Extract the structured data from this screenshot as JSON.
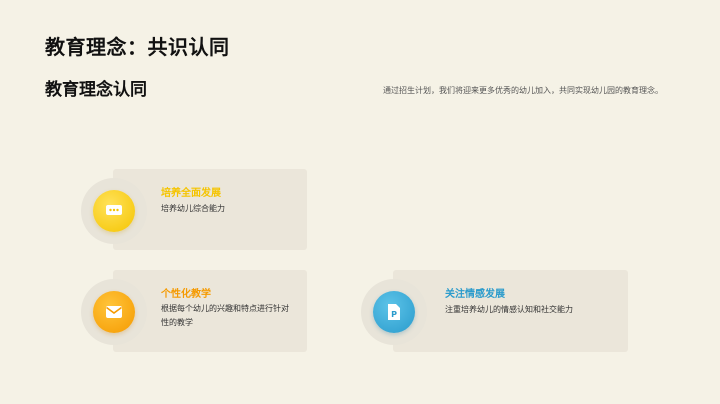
{
  "slide": {
    "title": "教育理念：共识认同",
    "subtitle": "教育理念认同",
    "description": "通过招生计划，我们将迎来更多优秀的幼儿加入，共同实现幼儿园的教育理念。"
  },
  "cards": [
    {
      "title": "培养全面发展",
      "text": "培养幼儿综合能力",
      "color": "#f5c400",
      "icon": "chat-bubble-icon"
    },
    {
      "title": "个性化教学",
      "text": "根据每个幼儿的兴趣和特点进行针对性的教学",
      "color": "#f59a00",
      "icon": "mail-icon"
    },
    {
      "title": "关注情感发展",
      "text": "注重培养幼儿的情感认知和社交能力",
      "color": "#2a9bcc",
      "icon": "document-p-icon"
    }
  ],
  "icon_glyphs": {
    "document_letter": "P"
  }
}
